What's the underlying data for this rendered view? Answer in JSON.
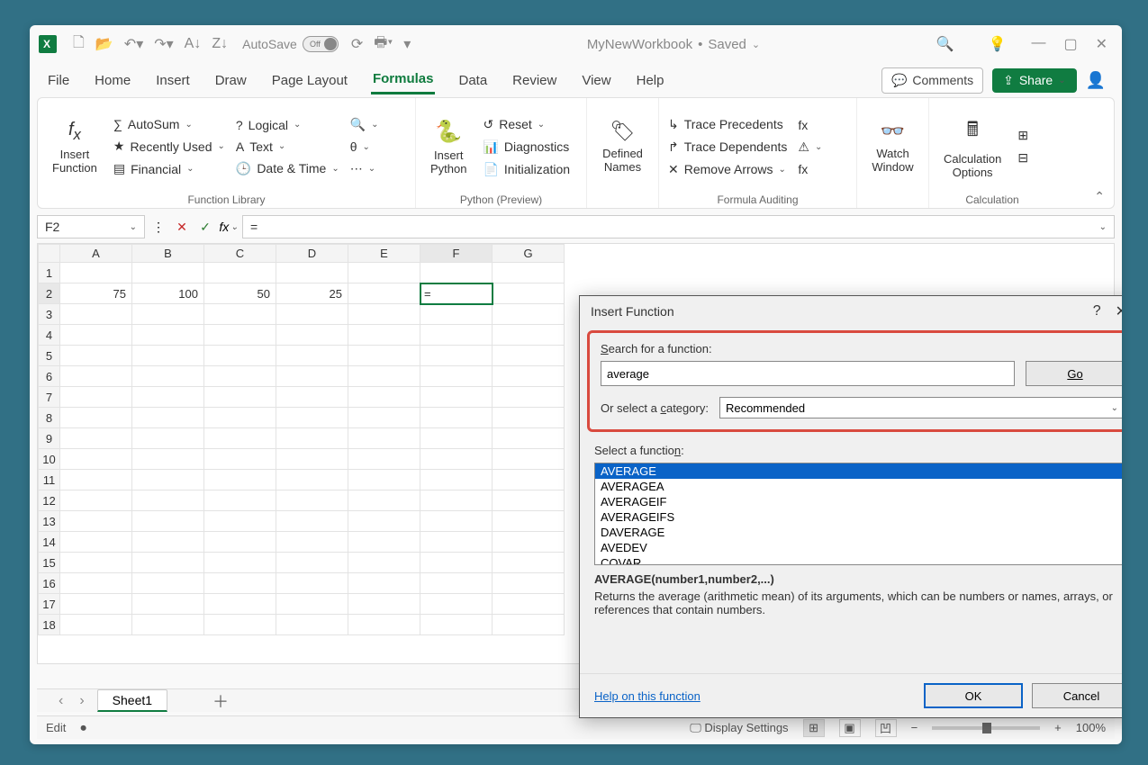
{
  "titlebar": {
    "autosave_label": "AutoSave",
    "autosave_state": "Off",
    "doc_name": "MyNewWorkbook",
    "save_state": "Saved"
  },
  "tabs": {
    "file": "File",
    "home": "Home",
    "insert": "Insert",
    "draw": "Draw",
    "page_layout": "Page Layout",
    "formulas": "Formulas",
    "data": "Data",
    "review": "Review",
    "view": "View",
    "help": "Help",
    "comments": "Comments",
    "share": "Share"
  },
  "ribbon": {
    "insert_function": "Insert\nFunction",
    "autosum": "AutoSum",
    "recently_used": "Recently Used",
    "financial": "Financial",
    "logical": "Logical",
    "text": "Text",
    "date_time": "Date & Time",
    "group_function_library": "Function Library",
    "insert_python": "Insert\nPython",
    "reset": "Reset",
    "diagnostics": "Diagnostics",
    "initialization": "Initialization",
    "group_python": "Python (Preview)",
    "defined_names": "Defined\nNames",
    "trace_precedents": "Trace Precedents",
    "trace_dependents": "Trace Dependents",
    "remove_arrows": "Remove Arrows",
    "group_formula_auditing": "Formula Auditing",
    "watch_window": "Watch\nWindow",
    "calc_options": "Calculation\nOptions",
    "group_calculation": "Calculation"
  },
  "formula_bar": {
    "namebox": "F2",
    "formula": "="
  },
  "grid": {
    "columns": [
      "A",
      "B",
      "C",
      "D",
      "E",
      "F",
      "G"
    ],
    "rows": [
      "1",
      "2",
      "3",
      "4",
      "5",
      "6",
      "7",
      "8",
      "9",
      "10",
      "11",
      "12",
      "13",
      "14",
      "15",
      "16",
      "17",
      "18"
    ],
    "active_cell_value": "=",
    "data": {
      "A2": "75",
      "B2": "100",
      "C2": "50",
      "D2": "25"
    }
  },
  "sheet_tabs": {
    "sheet1": "Sheet1"
  },
  "statusbar": {
    "mode": "Edit",
    "display_settings": "Display Settings",
    "zoom": "100%"
  },
  "dialog": {
    "title": "Insert Function",
    "search_label": "Search for a function:",
    "search_value": "average",
    "go": "Go",
    "category_label": "Or select a category:",
    "category_value": "Recommended",
    "select_label": "Select a function:",
    "list": [
      "AVERAGE",
      "AVERAGEA",
      "AVERAGEIF",
      "AVERAGEIFS",
      "DAVERAGE",
      "AVEDEV",
      "COVAR"
    ],
    "signature": "AVERAGE(number1,number2,...)",
    "description": "Returns the average (arithmetic mean) of its arguments, which can be numbers or names, arrays, or references that contain numbers.",
    "help_link": "Help on this function",
    "ok": "OK",
    "cancel": "Cancel"
  }
}
